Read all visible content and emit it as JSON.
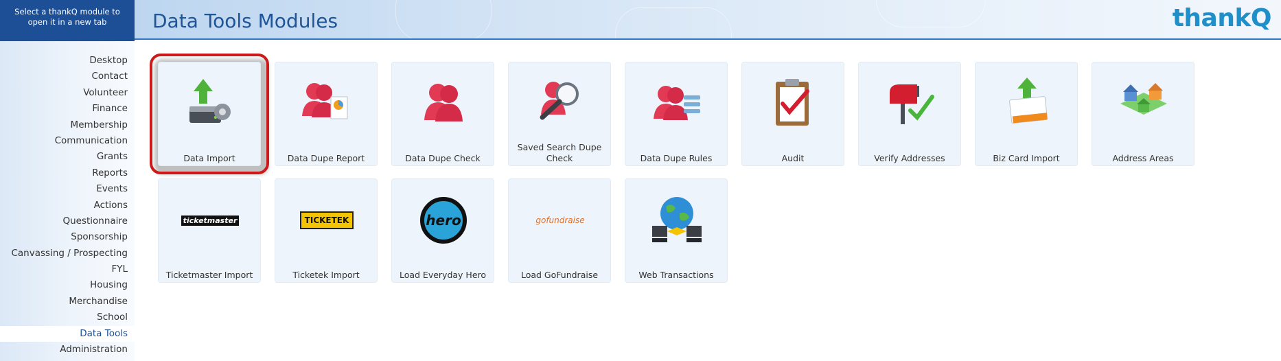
{
  "sidebar": {
    "header": "Select a thankQ module to open it in a new tab",
    "items": [
      {
        "label": "Desktop"
      },
      {
        "label": "Contact"
      },
      {
        "label": "Volunteer"
      },
      {
        "label": "Finance"
      },
      {
        "label": "Membership"
      },
      {
        "label": "Communication"
      },
      {
        "label": "Grants"
      },
      {
        "label": "Reports"
      },
      {
        "label": "Events"
      },
      {
        "label": "Actions"
      },
      {
        "label": "Questionnaire"
      },
      {
        "label": "Sponsorship"
      },
      {
        "label": "Canvassing / Prospecting"
      },
      {
        "label": "FYL"
      },
      {
        "label": "Housing"
      },
      {
        "label": "Merchandise"
      },
      {
        "label": "School"
      },
      {
        "label": "Data Tools",
        "active": true
      },
      {
        "label": "Administration"
      }
    ]
  },
  "header": {
    "title": "Data Tools Modules",
    "logo_text": "thankQ"
  },
  "tiles": [
    {
      "label": "Data Import",
      "icon": "data-import-icon",
      "selected": true
    },
    {
      "label": "Data Dupe Report",
      "icon": "dupe-report-icon"
    },
    {
      "label": "Data Dupe Check",
      "icon": "dupe-check-icon"
    },
    {
      "label": "Saved Search Dupe Check",
      "icon": "saved-search-icon"
    },
    {
      "label": "Data Dupe Rules",
      "icon": "dupe-rules-icon"
    },
    {
      "label": "Audit",
      "icon": "clipboard-check-icon"
    },
    {
      "label": "Verify Addresses",
      "icon": "mailbox-icon"
    },
    {
      "label": "Biz Card Import",
      "icon": "business-card-icon"
    },
    {
      "label": "Address Areas",
      "icon": "houses-map-icon"
    },
    {
      "label": "Ticketmaster Import",
      "icon": "ticketmaster-logo-icon",
      "logo_text": "ticketmaster"
    },
    {
      "label": "Ticketek Import",
      "icon": "ticketek-logo-icon",
      "logo_text": "TICKETEK"
    },
    {
      "label": "Load Everyday Hero",
      "icon": "everyday-hero-logo-icon",
      "logo_text": "hero"
    },
    {
      "label": "Load GoFundraise",
      "icon": "gofundraise-logo-icon",
      "logo_text": "gofundraise"
    },
    {
      "label": "Web Transactions",
      "icon": "globe-network-icon"
    }
  ],
  "colors": {
    "accent": "#1d4f96",
    "selection": "#cc1a1a",
    "tile_bg": "#eef4fb",
    "logo": "#1f8fc9"
  }
}
